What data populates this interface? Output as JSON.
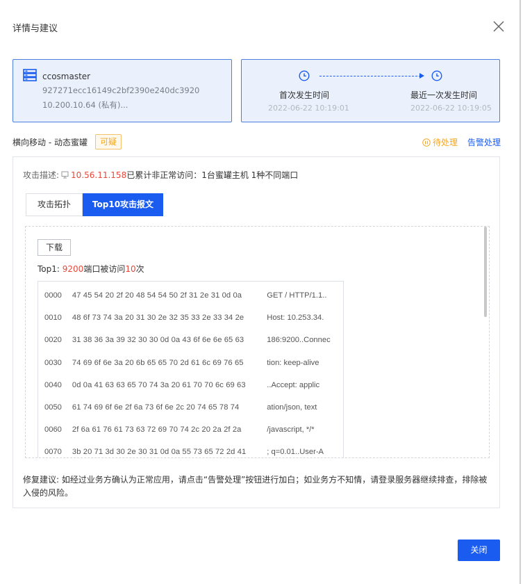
{
  "dialog": {
    "title": "详情与建议"
  },
  "host": {
    "name": "ccosmaster",
    "id": "927271ecc16149c2bf2390e240dc3920",
    "ip": "10.200.10.64 (私有)..."
  },
  "timeline": {
    "first_label": "首次发生时间",
    "first_value": "2022-06-22 10:19:01",
    "last_label": "最近一次发生时间",
    "last_value": "2022-06-22 10:19:05"
  },
  "alert": {
    "category": "横向移动 - 动态蜜罐",
    "badge": "可疑",
    "status": "待处理",
    "action_link": "告警处理"
  },
  "attack": {
    "desc_label": "攻击描述:",
    "source_ip": "10.56.11.158",
    "desc_text": "已累计非正常访问：1台蜜罐主机 1种不同端口"
  },
  "tabs": [
    {
      "label": "攻击拓扑",
      "active": false
    },
    {
      "label": "Top10攻击报文",
      "active": true
    }
  ],
  "packet": {
    "download_label": "下载",
    "top_prefix": "Top1:",
    "port": "9200",
    "mid_text": "端口被访问",
    "count": "10",
    "count_suffix": "次",
    "rows": [
      {
        "offset": "0000",
        "bytes": "47 45 54 20 2f 20 48 54 54 50 2f 31 2e 31 0d 0a",
        "ascii": "GET / HTTP/1.1.."
      },
      {
        "offset": "0010",
        "bytes": "48 6f 73 74 3a 20 31 30 2e 32 35 33 2e 33 34 2e",
        "ascii": "Host: 10.253.34."
      },
      {
        "offset": "0020",
        "bytes": "31 38 36 3a 39 32 30 30 0d 0a 43 6f 6e 6e 65 63",
        "ascii": "186:9200..Connec"
      },
      {
        "offset": "0030",
        "bytes": "74 69 6f 6e 3a 20 6b 65 65 70 2d 61 6c 69 76 65",
        "ascii": "tion: keep-alive"
      },
      {
        "offset": "0040",
        "bytes": "0d 0a 41 63 63 65 70 74 3a 20 61 70 70 6c 69 63",
        "ascii": "..Accept: applic"
      },
      {
        "offset": "0050",
        "bytes": "61 74 69 6f 6e 2f 6a 73 6f 6e 2c 20 74 65 78 74",
        "ascii": "ation/json, text"
      },
      {
        "offset": "0060",
        "bytes": "2f 6a 61 76 61 73 63 72 69 70 74 2c 20 2a 2f 2a",
        "ascii": "/javascript, */*"
      },
      {
        "offset": "0070",
        "bytes": "3b 20 71 3d 30 2e 30 31 0d 0a 55 73 65 72 2d 41",
        "ascii": "; q=0.01..User-A"
      }
    ]
  },
  "fix": {
    "label": "修复建议:",
    "text": "如经过业务方确认为正常应用，请点击“告警处理”按钮进行加白；如业务方不知情，请登录服务器继续排查，排除被入侵的风险。"
  },
  "footer": {
    "close_label": "关闭"
  },
  "colors": {
    "accent": "#1a5cf0",
    "warning": "#f5a623",
    "danger": "#e8473a",
    "card_bg": "#eaf1fd"
  },
  "icons": [
    "close-icon",
    "server-icon",
    "clock-icon",
    "pause-circle-icon",
    "device-icon"
  ]
}
